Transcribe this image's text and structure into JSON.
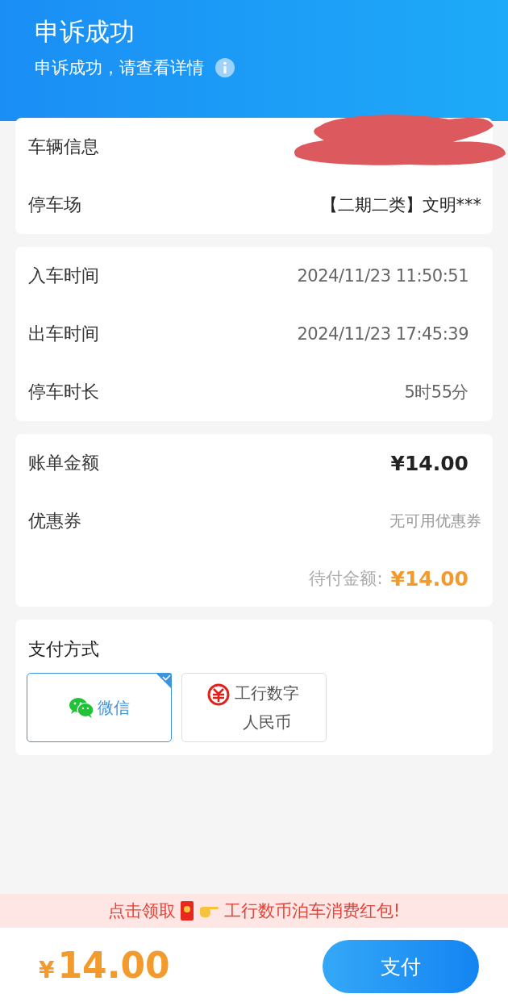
{
  "header": {
    "title": "申诉成功",
    "subtitle": "申诉成功，请查看详情"
  },
  "vehicle_card": {
    "rows": [
      {
        "label": "车辆信息",
        "value_redacted": true
      },
      {
        "label": "停车场",
        "value": "【二期二类】文明***"
      }
    ]
  },
  "time_card": {
    "rows": [
      {
        "label": "入车时间",
        "value": "2024/11/23 11:50:51"
      },
      {
        "label": "出车时间",
        "value": "2024/11/23 17:45:39"
      },
      {
        "label": "停车时长",
        "value": "5时55分"
      }
    ]
  },
  "bill_card": {
    "amount_label": "账单金额",
    "amount": "¥14.00",
    "coupon_label": "优惠券",
    "coupon_value": "无可用优惠券",
    "due_label": "待付金额:",
    "due_amount": "¥14.00"
  },
  "payment": {
    "title": "支付方式",
    "options": [
      {
        "kind": "wechat",
        "label": "微信",
        "selected": true
      },
      {
        "kind": "ecny",
        "label": "工行数字人民币",
        "selected": false
      }
    ]
  },
  "banner": {
    "text_before": "点击领取",
    "text_after": "工行数币泊车消费红包!"
  },
  "footer": {
    "currency": "¥",
    "total": "14.00",
    "pay_button": "支付"
  }
}
